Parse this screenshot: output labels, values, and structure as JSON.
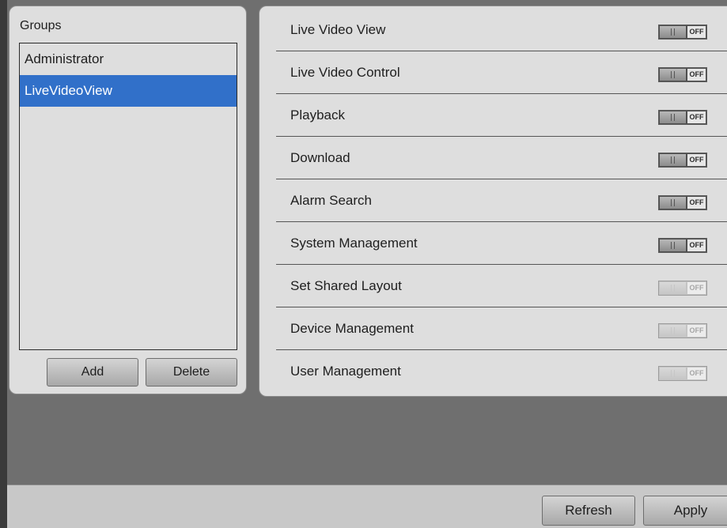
{
  "groups": {
    "title": "Groups",
    "items": [
      {
        "label": "Administrator",
        "selected": false
      },
      {
        "label": "LiveVideoView",
        "selected": true
      }
    ],
    "add_label": "Add",
    "delete_label": "Delete"
  },
  "permissions": {
    "toggle_text": "OFF",
    "items": [
      {
        "label": "Live Video View",
        "state": "off",
        "enabled": true
      },
      {
        "label": "Live Video Control",
        "state": "off",
        "enabled": true
      },
      {
        "label": "Playback",
        "state": "off",
        "enabled": true
      },
      {
        "label": "Download",
        "state": "off",
        "enabled": true
      },
      {
        "label": "Alarm Search",
        "state": "off",
        "enabled": true
      },
      {
        "label": "System Management",
        "state": "off",
        "enabled": true
      },
      {
        "label": "Set Shared Layout",
        "state": "off",
        "enabled": false
      },
      {
        "label": "Device Management",
        "state": "off",
        "enabled": false
      },
      {
        "label": "User Management",
        "state": "off",
        "enabled": false
      }
    ]
  },
  "footer": {
    "refresh_label": "Refresh",
    "apply_label": "Apply"
  },
  "colors": {
    "selection": "#3170c9",
    "background": "#6f6f6f",
    "panel": "#dedede"
  }
}
